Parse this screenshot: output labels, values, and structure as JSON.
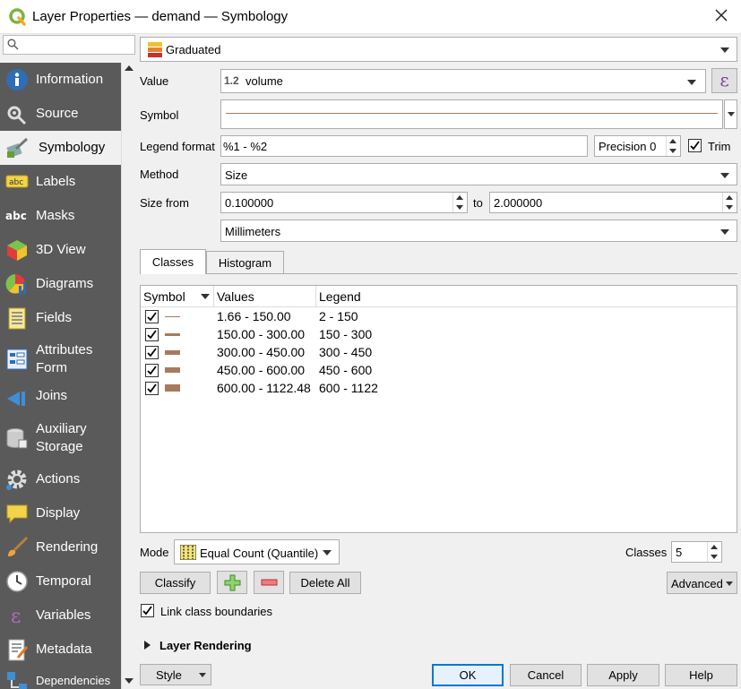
{
  "window": {
    "title": "Layer Properties — demand — Symbology",
    "icons": {
      "app": "qgis-icon",
      "close": "close-icon"
    }
  },
  "search": {
    "placeholder": ""
  },
  "sidebar": {
    "items": [
      {
        "label": "Information",
        "icon": "info-icon"
      },
      {
        "label": "Source",
        "icon": "source-icon"
      },
      {
        "label": "Symbology",
        "icon": "paintbrush-icon",
        "active": true
      },
      {
        "label": "Labels",
        "icon": "labels-icon"
      },
      {
        "label": "Masks",
        "icon": "masks-icon"
      },
      {
        "label": "3D View",
        "icon": "cube-icon"
      },
      {
        "label": "Diagrams",
        "icon": "diagram-icon"
      },
      {
        "label": "Fields",
        "icon": "fields-icon"
      },
      {
        "label": "Attributes\nForm",
        "icon": "form-icon"
      },
      {
        "label": "Joins",
        "icon": "joins-icon"
      },
      {
        "label": "Auxiliary\nStorage",
        "icon": "database-icon"
      },
      {
        "label": "Actions",
        "icon": "gear-icon"
      },
      {
        "label": "Display",
        "icon": "speech-bubble-icon"
      },
      {
        "label": "Rendering",
        "icon": "brush-icon"
      },
      {
        "label": "Temporal",
        "icon": "clock-icon"
      },
      {
        "label": "Variables",
        "icon": "epsilon-icon"
      },
      {
        "label": "Metadata",
        "icon": "metadata-icon"
      },
      {
        "label": "Dependencies",
        "icon": "dependencies-icon"
      }
    ]
  },
  "renderer": {
    "selected": "Graduated"
  },
  "form": {
    "value_label": "Value",
    "value_type": "1.2",
    "value": "volume",
    "expression_icon": "ε",
    "symbol_label": "Symbol",
    "legend_format_label": "Legend format",
    "legend_format": "%1 - %2",
    "precision_text": "Precision 0",
    "trim_label": "Trim",
    "trim_checked": true,
    "method_label": "Method",
    "method": "Size",
    "size_from_label": "Size from",
    "size_from": "0.100000",
    "to_label": "to",
    "size_to": "2.000000",
    "unit": "Millimeters"
  },
  "tabs": [
    {
      "label": "Classes",
      "active": true
    },
    {
      "label": "Histogram",
      "active": false
    }
  ],
  "table": {
    "headers": [
      "Symbol",
      "Values",
      "Legend"
    ],
    "rows": [
      {
        "checked": true,
        "values": "1.66 - 150.00",
        "legend": "2 - 150",
        "thickness": 1
      },
      {
        "checked": true,
        "values": "150.00 - 300.00",
        "legend": "150 - 300",
        "thickness": 3
      },
      {
        "checked": true,
        "values": "300.00 - 450.00",
        "legend": "300 - 450",
        "thickness": 5
      },
      {
        "checked": true,
        "values": "450.00 - 600.00",
        "legend": "450 - 600",
        "thickness": 7
      },
      {
        "checked": true,
        "values": "600.00 - 1122.48",
        "legend": "600 - 1122",
        "thickness": 9
      }
    ],
    "symbol_color": "#a87a5c"
  },
  "mode": {
    "label": "Mode",
    "value": "Equal Count (Quantile)",
    "classes_label": "Classes",
    "classes": "5"
  },
  "buttons": {
    "classify": "Classify",
    "add_icon": "plus-icon",
    "remove_icon": "minus-icon",
    "delete_all": "Delete All",
    "advanced": "Advanced",
    "link_label": "Link class boundaries",
    "link_checked": true,
    "layer_rendering": "Layer Rendering",
    "style": "Style",
    "ok": "OK",
    "cancel": "Cancel",
    "apply": "Apply",
    "help": "Help"
  },
  "colors": {
    "sidebar_bg": "#5a5a5a",
    "accent": "#0078d7"
  }
}
